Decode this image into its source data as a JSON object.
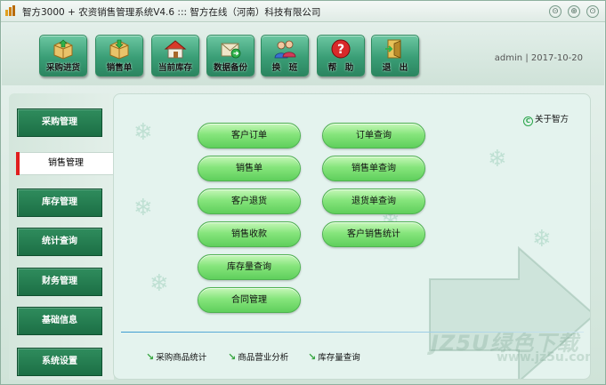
{
  "title": "智方3000 + 农资销售管理系统V4.6 ::: 智方在线（河南）科技有限公司",
  "window_controls": {
    "minimize": "⊝",
    "maximize": "⊕",
    "close": "⊙"
  },
  "toolbar": {
    "buttons": [
      {
        "label": "采购进货",
        "icon": "box-in-icon"
      },
      {
        "label": "销售单",
        "icon": "box-out-icon"
      },
      {
        "label": "当前库存",
        "icon": "house-icon"
      },
      {
        "label": "数据备份",
        "icon": "backup-icon"
      },
      {
        "label": "换　班",
        "icon": "users-icon"
      },
      {
        "label": "帮　助",
        "icon": "help-icon"
      },
      {
        "label": "退　出",
        "icon": "exit-icon"
      }
    ],
    "user": "admin",
    "separator": "|",
    "date": "2017-10-20"
  },
  "sidebar": {
    "items": [
      {
        "label": "采购管理",
        "active": false
      },
      {
        "label": "销售管理",
        "active": true
      },
      {
        "label": "库存管理",
        "active": false
      },
      {
        "label": "统计查询",
        "active": false
      },
      {
        "label": "财务管理",
        "active": false
      },
      {
        "label": "基础信息",
        "active": false
      },
      {
        "label": "系统设置",
        "active": false
      }
    ]
  },
  "main": {
    "about": "关于智方",
    "about_icon": "C",
    "left_buttons": [
      "客户订单",
      "销售单",
      "客户退货",
      "销售收款",
      "库存量查询",
      "合同管理"
    ],
    "right_buttons": [
      "订单查询",
      "销售单查询",
      "退货单查询",
      "客户销售统计"
    ],
    "quick_links": [
      "采购商品统计",
      "商品营业分析",
      "库存量查询"
    ],
    "watermark": "JZ5U绿色下载",
    "watermark_url": "www.jz5u.com"
  },
  "colors": {
    "accent_green": "#3a9e76",
    "pill_green": "#86e57c",
    "active_marker": "#e01e1e"
  }
}
